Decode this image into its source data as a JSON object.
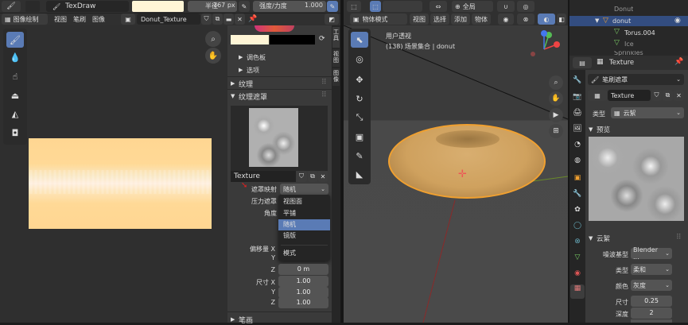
{
  "top_header": {
    "mode": "TexDraw",
    "radius_label": "半径",
    "radius_value": "167 px",
    "strength_label": "强度/力度",
    "strength_value": "1.000"
  },
  "image_editor": {
    "mode_label": "图像绘制",
    "menus": [
      "视图",
      "笔刷",
      "图像"
    ],
    "image_name": "Donut_Texture"
  },
  "tool_panel": {
    "tabs": [
      "工具",
      "视图",
      "图像"
    ],
    "palette": "调色板",
    "options": "选项",
    "texture": "纹理",
    "texture_mask": "纹理遮罩",
    "mask_texture_name": "Texture",
    "mask_mapping_label": "遮罩映射",
    "mask_mapping_value": "随机",
    "pressure_mask_label": "压力遮罩",
    "angle_label": "角度",
    "dropdown_options": [
      "视图面",
      "平铺",
      "随机",
      "镜版"
    ],
    "dropdown_mode": "模式",
    "offset_label": "偏移量 X",
    "y_label": "Y",
    "z_label": "Z",
    "offset_z": "0 m",
    "size_label": "尺寸 X",
    "size_x": "1.00",
    "size_y": "1.00",
    "size_z": "1.00",
    "stroke_section": "笔画"
  },
  "viewport": {
    "mode_label": "物体模式",
    "menus": [
      "视图",
      "选择",
      "添加",
      "物体"
    ],
    "transform": "全局",
    "view_name": "用户透视",
    "scene_info": "(138) 场景集合 | donut"
  },
  "outliner": {
    "items": [
      "Donut",
      "donut",
      "Torus.004",
      "Ice",
      "Sprinkles"
    ]
  },
  "properties": {
    "title": "Texture",
    "brush_mask": "笔刷遮罩",
    "texture_name": "Texture",
    "type_label": "类型",
    "type_value": "云絮",
    "preview": "预览",
    "clouds": "云絮",
    "noise_basis_label": "噪波基型",
    "noise_basis_value": "Blender ...",
    "kind_label": "类型",
    "kind_value": "柔和",
    "color_label": "颜色",
    "color_value": "灰度",
    "size_label": "尺寸",
    "size_value": "0.25",
    "depth_label": "深度",
    "depth_value": "2"
  }
}
